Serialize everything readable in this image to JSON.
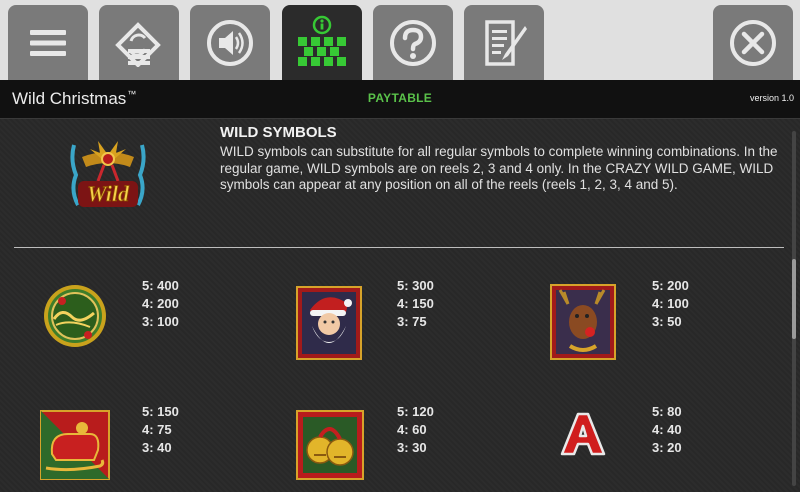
{
  "toolbar": {
    "tabs": [
      {
        "icon": "menu-icon",
        "active": false
      },
      {
        "icon": "autoplay-icon",
        "active": false
      },
      {
        "icon": "sound-icon",
        "active": false
      },
      {
        "icon": "paytable-icon",
        "active": true
      },
      {
        "icon": "help-icon",
        "active": false
      },
      {
        "icon": "history-icon",
        "active": false
      },
      {
        "icon": "close-icon",
        "active": false
      }
    ]
  },
  "header": {
    "game_title": "Wild Christmas",
    "trademark": "™",
    "section_title": "PAYTABLE",
    "version": "version 1.0"
  },
  "wild": {
    "heading": "WILD SYMBOLS",
    "icon_label": "Wild",
    "description": "WILD symbols can substitute for all regular symbols to complete winning combinations. In the regular game, WILD symbols are on reels 2, 3 and 4 only. In the CRAZY WILD GAME, WILD symbols can appear at any position on all of the reels (reels 1, 2, 3, 4 and 5)."
  },
  "symbols": [
    {
      "icon": "merry-christmas-ornament-icon",
      "pays": [
        "5: 400",
        "4: 200",
        "3: 100"
      ]
    },
    {
      "icon": "santa-claus-icon",
      "pays": [
        "5: 300",
        "4: 150",
        "3: 75"
      ]
    },
    {
      "icon": "reindeer-icon",
      "pays": [
        "5: 200",
        "4: 100",
        "3: 50"
      ]
    },
    {
      "icon": "sleigh-icon",
      "pays": [
        "5: 150",
        "4: 75",
        "3: 40"
      ]
    },
    {
      "icon": "jingle-bells-icon",
      "pays": [
        "5: 120",
        "4: 60",
        "3: 30"
      ]
    },
    {
      "icon": "letter-a-icon",
      "pays": [
        "5: 80",
        "4: 40",
        "3: 20"
      ]
    }
  ],
  "colors": {
    "tab_bg": "#7a7a7a",
    "tab_active_bg": "#2b2b2b",
    "tab_icon": "#e8e8e8",
    "paytable_green": "#37c935",
    "title_bar": "#111111",
    "content_bg": "#282828"
  }
}
